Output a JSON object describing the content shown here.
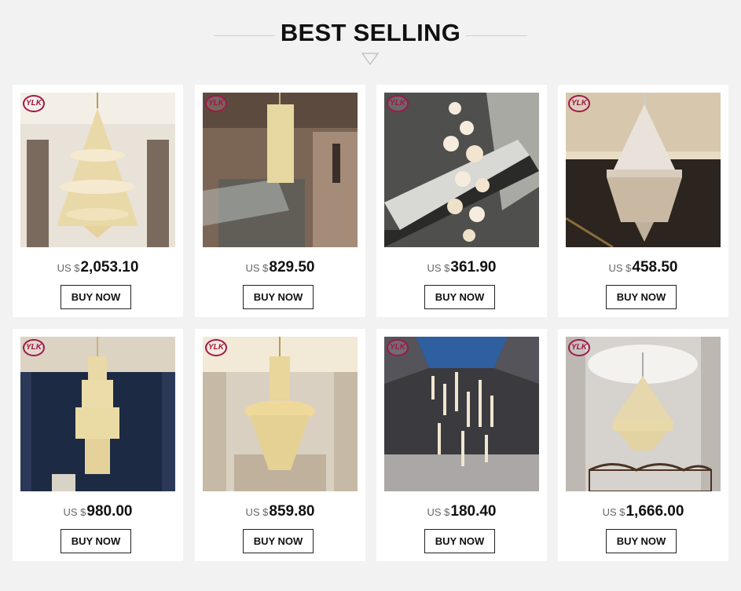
{
  "header": {
    "title": "BEST SELLING"
  },
  "products": [
    {
      "currency": "US $",
      "price": "2,053.10",
      "buy_label": "BUY NOW",
      "logo": "YLK"
    },
    {
      "currency": "US $",
      "price": "829.50",
      "buy_label": "BUY NOW",
      "logo": "YLK"
    },
    {
      "currency": "US $",
      "price": "361.90",
      "buy_label": "BUY NOW",
      "logo": "YLK"
    },
    {
      "currency": "US $",
      "price": "458.50",
      "buy_label": "BUY NOW",
      "logo": "YLK"
    },
    {
      "currency": "US $",
      "price": "980.00",
      "buy_label": "BUY NOW",
      "logo": "YLK"
    },
    {
      "currency": "US $",
      "price": "859.80",
      "buy_label": "BUY NOW",
      "logo": "YLK"
    },
    {
      "currency": "US $",
      "price": "180.40",
      "buy_label": "BUY NOW",
      "logo": "YLK"
    },
    {
      "currency": "US $",
      "price": "1,666.00",
      "buy_label": "BUY NOW",
      "logo": "YLK"
    }
  ],
  "colors": {
    "background": "#f2f2f2",
    "card": "#ffffff",
    "logo": "#a0174a"
  },
  "icons": {
    "divider": "triangle-down-icon"
  }
}
